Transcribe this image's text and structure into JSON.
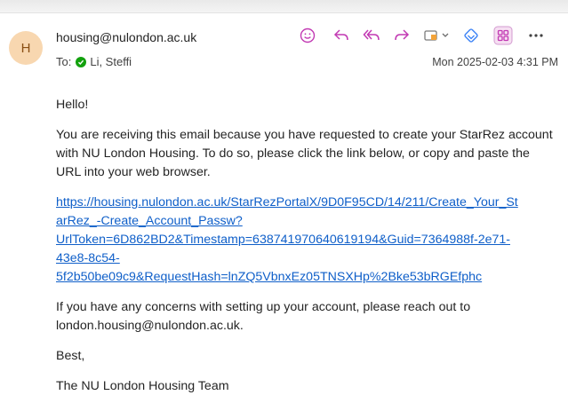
{
  "email": {
    "avatar_initial": "H",
    "sender": "housing@nulondon.ac.uk",
    "to_label": "To:",
    "recipient": "Li, Steffi",
    "datetime": "Mon 2025-02-03 4:31 PM"
  },
  "toolbar_icons": [
    "smiley-icon",
    "reply-icon",
    "reply-all-icon",
    "forward-icon",
    "teams-share-icon",
    "loop-icon",
    "apps-icon",
    "more-icon"
  ],
  "message": {
    "greeting": "Hello!",
    "paragraph1": "You are receiving this email because you have requested to create your StarRez account with NU London Housing. To do so, please click the link below, or copy and paste the URL into your web browser.",
    "link_lines": [
      "https://housing.nulondon.ac.uk/StarRezPortalX/9D0F95CD/14/211/Create_Your_St",
      "arRez_-Create_Account_Passw?",
      "UrlToken=6D862BD2&Timestamp=638741970640619194&Guid=7364988f-2e71-",
      "43e8-8c54-",
      "5f2b50be09c9&RequestHash=lnZQ5VbnxEz05TNSXHp%2Bke53bRGEfphc"
    ],
    "paragraph2": "If you have any concerns with setting up your account, please reach out to london.housing@nulondon.ac.uk.",
    "signoff": "Best,",
    "signature": "The NU London Housing Team"
  },
  "colors": {
    "accent_pink": "#c239b3",
    "accent_blue": "#0f5fc9",
    "avatar_bg": "#f8d7b0",
    "presence_green": "#13a10e"
  }
}
